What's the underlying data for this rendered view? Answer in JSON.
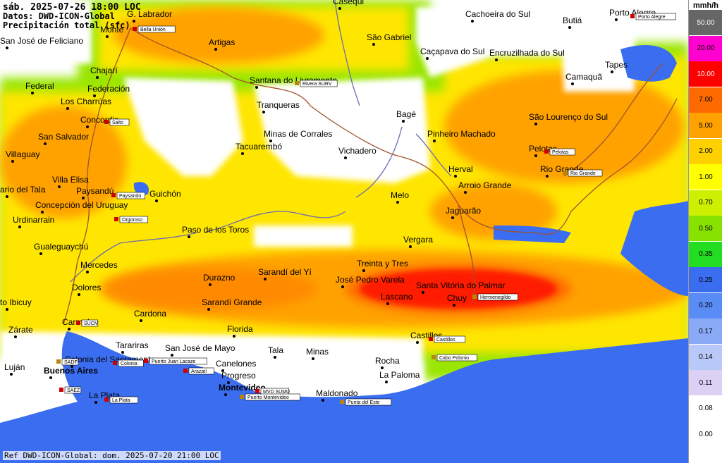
{
  "header": {
    "line1": "sáb. 2025-07-26 18:00 LOC",
    "line2": "Datos: DWD-ICON-Global",
    "line3": "Precipitación total (sfc)"
  },
  "footer": "Ref DWD-ICON-Global: dom. 2025-07-20 21:00 LOC",
  "legend": {
    "unit": "mmh/h",
    "items": [
      {
        "label": "50.00",
        "color": "#666666"
      },
      {
        "label": "20.00",
        "color": "#ff00d0"
      },
      {
        "label": "10.00",
        "color": "#ff0000"
      },
      {
        "label": "7.00",
        "color": "#ff6a00"
      },
      {
        "label": "5.00",
        "color": "#ffa200"
      },
      {
        "label": "2.00",
        "color": "#ffd000"
      },
      {
        "label": "1.00",
        "color": "#ffff00"
      },
      {
        "label": "0.70",
        "color": "#ccf000"
      },
      {
        "label": "0.50",
        "color": "#88e200"
      },
      {
        "label": "0.35",
        "color": "#22dd22"
      },
      {
        "label": "0.25",
        "color": "#3a6df0"
      },
      {
        "label": "0.20",
        "color": "#5a8cf5"
      },
      {
        "label": "0.17",
        "color": "#8aaaf8"
      },
      {
        "label": "0.14",
        "color": "#b8c8f8"
      },
      {
        "label": "0.11",
        "color": "#dcd0f4"
      },
      {
        "label": "0.08",
        "color": "#ffffff"
      },
      {
        "label": "0.00",
        "color": "#ffffff"
      }
    ]
  },
  "colors": {
    "ocean": "#3a6df0",
    "land": "#ffffff",
    "border": "#a0522d",
    "river": "#6b6bb5"
  },
  "places": [
    {
      "name": "Casequi"
    },
    {
      "name": "Cachoeira do Sul"
    },
    {
      "name": "Porto Alegre"
    },
    {
      "name": "G. Labrador"
    },
    {
      "name": "Monte"
    },
    {
      "name": "San José de Feliciano"
    },
    {
      "name": "Artigas"
    },
    {
      "name": "São Gabriel"
    },
    {
      "name": "Butiá"
    },
    {
      "name": "Caçapava do Sul"
    },
    {
      "name": "Encruzilhada do Sul"
    },
    {
      "name": "Camaquã"
    },
    {
      "name": "Tapes"
    },
    {
      "name": "Chajarí"
    },
    {
      "name": "Federal"
    },
    {
      "name": "Federación"
    },
    {
      "name": "Los Charrúas"
    },
    {
      "name": "Santana do Livramento"
    },
    {
      "name": "Tranqueras"
    },
    {
      "name": "Concordia"
    },
    {
      "name": "Bagé"
    },
    {
      "name": "São Lourenço do Sul"
    },
    {
      "name": "San Salvador"
    },
    {
      "name": "Minas de Corrales"
    },
    {
      "name": "Tacuarembó"
    },
    {
      "name": "Pinheiro Machado"
    },
    {
      "name": "Pelotas"
    },
    {
      "name": "Villaguay"
    },
    {
      "name": "Vichadero"
    },
    {
      "name": "Herval"
    },
    {
      "name": "Rio Grande"
    },
    {
      "name": "Villa Elisa"
    },
    {
      "name": "Arroio Grande"
    },
    {
      "name": "Paysandú"
    },
    {
      "name": "ario del Tala"
    },
    {
      "name": "Guichón"
    },
    {
      "name": "Concepción del Uruguay"
    },
    {
      "name": "Melo"
    },
    {
      "name": "Jaguarão"
    },
    {
      "name": "Urdinarrain"
    },
    {
      "name": "Paso de los Toros"
    },
    {
      "name": "Vergara"
    },
    {
      "name": "Gualeguaychú"
    },
    {
      "name": "Mercedes"
    },
    {
      "name": "Treinta y Tres"
    },
    {
      "name": "Sarandí del Yí"
    },
    {
      "name": "Durazno"
    },
    {
      "name": "José Pedro Varela"
    },
    {
      "name": "Santa Vitória do Palmar"
    },
    {
      "name": "Dolores"
    },
    {
      "name": "Lascano"
    },
    {
      "name": "Chuy"
    },
    {
      "name": "to Ibicuy"
    },
    {
      "name": "Sarandí Grande"
    },
    {
      "name": "Cardona"
    },
    {
      "name": "Carmelo"
    },
    {
      "name": "Zárate"
    },
    {
      "name": "Florida"
    },
    {
      "name": "Castillos"
    },
    {
      "name": "Tarariras"
    },
    {
      "name": "San José de Mayo"
    },
    {
      "name": "Tala"
    },
    {
      "name": "Minas"
    },
    {
      "name": "Colonia del Sacramento"
    },
    {
      "name": "Luján"
    },
    {
      "name": "Buenos Aires"
    },
    {
      "name": "Canelones"
    },
    {
      "name": "Rocha"
    },
    {
      "name": "Progreso"
    },
    {
      "name": "La Paloma"
    },
    {
      "name": "Montevideo"
    },
    {
      "name": "Maldonado"
    },
    {
      "name": "La Plata"
    }
  ],
  "stations": [
    {
      "name": "Bella Unión"
    },
    {
      "name": "Porto Alegre"
    },
    {
      "name": "Rivera SURV"
    },
    {
      "name": "Salto"
    },
    {
      "name": "Pelotas"
    },
    {
      "name": "Rio Grande"
    },
    {
      "name": "Paysandú"
    },
    {
      "name": "Orgoroso"
    },
    {
      "name": "Hermenegildo"
    },
    {
      "name": "SUCM"
    },
    {
      "name": "Castillos"
    },
    {
      "name": "SADF"
    },
    {
      "name": "Colonia"
    },
    {
      "name": "Puerto Juan Lacaze"
    },
    {
      "name": "Cabo Polonio"
    },
    {
      "name": "Arazatí"
    },
    {
      "name": "MVD SUMU"
    },
    {
      "name": "Puerto Montevideo"
    },
    {
      "name": "SAEZ"
    },
    {
      "name": "La Plata"
    },
    {
      "name": "Punta del Este"
    }
  ]
}
